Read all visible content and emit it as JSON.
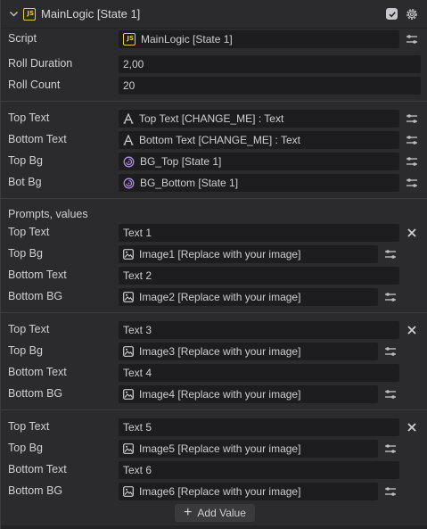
{
  "header": {
    "title": "MainLogic [State 1]",
    "enabled": true
  },
  "fields": {
    "script": {
      "label": "Script",
      "value": "MainLogic [State 1]"
    },
    "roll_duration": {
      "label": "Roll Duration",
      "value": "2,00"
    },
    "roll_count": {
      "label": "Roll Count",
      "value": "20"
    },
    "top_text": {
      "label": "Top Text",
      "value": "Top Text [CHANGE_ME] : Text"
    },
    "bottom_text": {
      "label": "Bottom Text",
      "value": "Bottom Text [CHANGE_ME] : Text"
    },
    "top_bg": {
      "label": "Top Bg",
      "value": "BG_Top [State 1]"
    },
    "bot_bg": {
      "label": "Bot Bg",
      "value": "BG_Bottom [State 1]"
    }
  },
  "prompts": {
    "section_label": "Prompts, values",
    "labels": {
      "top_text": "Top Text",
      "top_bg": "Top Bg",
      "bottom_text": "Bottom Text",
      "bottom_bg": "Bottom BG"
    },
    "items": [
      {
        "top_text": "Text 1",
        "top_bg": "Image1 [Replace with your image]",
        "bottom_text": "Text 2",
        "bottom_bg": "Image2 [Replace with your image]"
      },
      {
        "top_text": "Text 3",
        "top_bg": "Image3 [Replace with your image]",
        "bottom_text": "Text 4",
        "bottom_bg": "Image4 [Replace with your image]"
      },
      {
        "top_text": "Text 5",
        "top_bg": "Image5 [Replace with your image]",
        "bottom_text": "Text 6",
        "bottom_bg": "Image6 [Replace with your image]"
      }
    ],
    "add_label": "Add Value"
  },
  "icons": {
    "collapse": "chevron-down-icon",
    "script": "js-file-icon",
    "text_component": "text-a-icon",
    "state_ref": "state-swirl-icon",
    "image": "image-icon",
    "slider": "sliders-icon",
    "remove": "close-icon",
    "settings": "gear-icon"
  },
  "colors": {
    "background": "#2b2b2d",
    "field": "#1d1d1f",
    "js_accent": "#e9c84b",
    "state_accent": "#a98be0"
  }
}
